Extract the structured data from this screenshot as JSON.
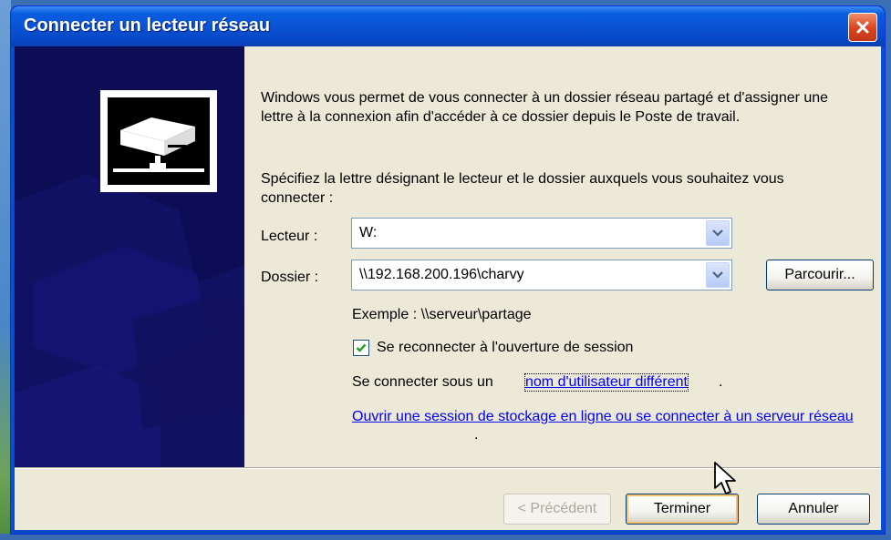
{
  "window": {
    "title": "Connecter un lecteur réseau",
    "close_symbol": "✕"
  },
  "content": {
    "intro": "Windows vous permet de vous connecter à un dossier réseau partagé et d'assigner une lettre à la connexion afin d'accéder à ce dossier depuis le Poste de travail.",
    "instruction": "Spécifiez la lettre désignant le lecteur et le dossier auxquels vous souhaitez vous connecter :",
    "drive": {
      "label": "Lecteur :",
      "value": "W:"
    },
    "folder": {
      "label": "Dossier :",
      "value": "\\\\192.168.200.196\\charvy"
    },
    "browse_label": "Parcourir...",
    "example": "Exemple : \\\\serveur\\partage",
    "reconnect": {
      "label": "Se reconnecter à l'ouverture de session",
      "checked": true
    },
    "connect_as_prefix": "Se connecter sous un",
    "connect_as_link": "nom d'utilisateur différent",
    "period": ".",
    "storage_link": "Ouvrir une session de stockage en ligne ou se connecter à un serveur réseau"
  },
  "footer": {
    "back_label": "< Précédent",
    "finish_label": "Terminer",
    "cancel_label": "Annuler"
  },
  "icons": {
    "drive": "network-drive-icon",
    "close": "close-icon",
    "dropdown": "chevron-down-icon",
    "check": "checkmark-icon",
    "cursor": "mouse-pointer-icon"
  },
  "colors": {
    "titlebar": "#0a53d6",
    "side_panel": "#0c0c4c",
    "dialog_bg": "#ece9d8",
    "link": "#0000ff",
    "close_button": "#d9441c"
  }
}
